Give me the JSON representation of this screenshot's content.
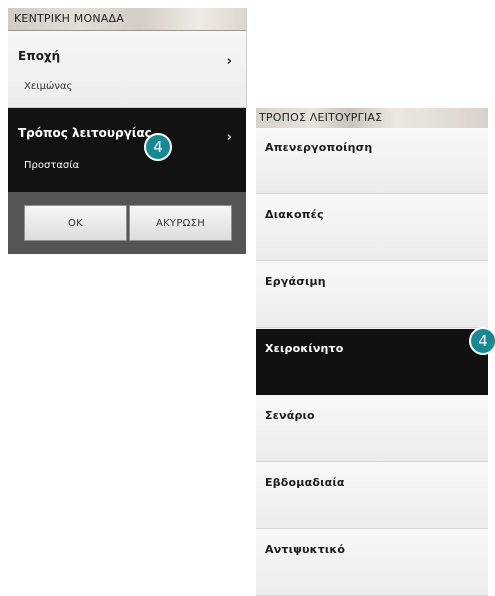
{
  "central_unit": {
    "header": "ΚΕΝΤΡΙΚΗ ΜΟΝΑΔΑ",
    "season": {
      "title": "Εποχή",
      "value": "Χειμώνας",
      "chevron": "›"
    },
    "mode": {
      "title": "Τρόπος λειτουργίας",
      "value": "Προστασία",
      "chevron": "›"
    },
    "ok_label": "OK",
    "cancel_label": "ΑΚΥΡΩΣΗ"
  },
  "operating_mode": {
    "header": "ΤΡΟΠΟΣ ΛΕΙΤΟΥΡΓΙΑΣ",
    "options": [
      {
        "label": "Απενεργοποίηση",
        "selected": false
      },
      {
        "label": "Διακοπές",
        "selected": false
      },
      {
        "label": "Εργάσιμη",
        "selected": false
      },
      {
        "label": "Χειροκίνητο",
        "selected": true
      },
      {
        "label": "Σενάριο",
        "selected": false
      },
      {
        "label": "Εβδομαδιαία",
        "selected": false
      },
      {
        "label": "Αντιψυκτικό",
        "selected": false
      }
    ]
  },
  "callouts": {
    "left": "4",
    "right": "4"
  },
  "colors": {
    "badge": "#148a95",
    "selected_row": "#111111",
    "button_bar": "#555555"
  }
}
